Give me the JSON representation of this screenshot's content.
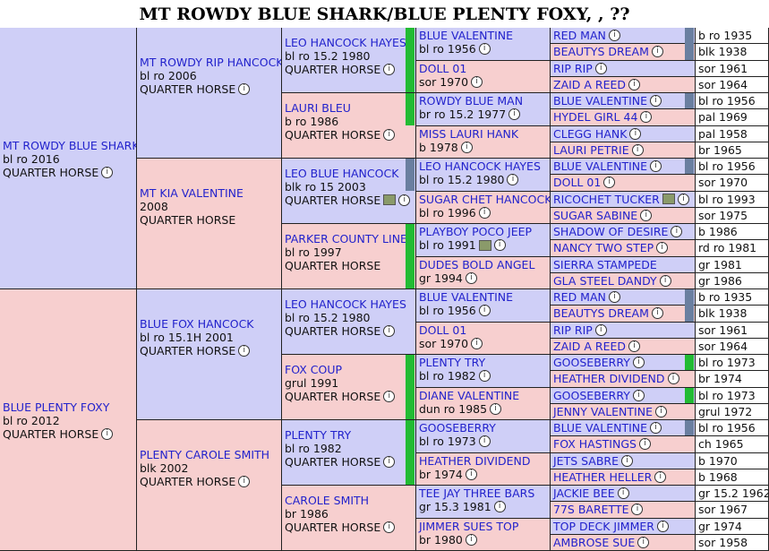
{
  "title": "MT ROWDY BLUE SHARK/BLUE PLENTY FOXY, , ??",
  "gen1": [
    {
      "name": "MT ROWDY BLUE SHARK",
      "line2": "bl ro 2016",
      "line3": "QUARTER HORSE"
    },
    {
      "name": "BLUE PLENTY FOXY",
      "line2": "bl ro 2012",
      "line3": "QUARTER HORSE"
    }
  ],
  "gen2": [
    {
      "name": "MT ROWDY RIP HANCOCK",
      "line2": "bl ro 2006",
      "line3": "QUARTER HORSE"
    },
    {
      "name": "MT KIA VALENTINE",
      "line2": "2008",
      "line3": "QUARTER HORSE"
    },
    {
      "name": "BLUE FOX HANCOCK",
      "line2": "bl ro 15.1H 2001",
      "line3": "QUARTER HORSE"
    },
    {
      "name": "PLENTY CAROLE SMITH",
      "line2": "blk 2002",
      "line3": "QUARTER HORSE"
    }
  ],
  "gen3": [
    {
      "name": "LEO HANCOCK HAYES",
      "line2": "bl ro 15.2 1980",
      "line3": "QUARTER HORSE"
    },
    {
      "name": "LAURI BLEU",
      "line2": "b ro 1986",
      "line3": "QUARTER HORSE"
    },
    {
      "name": "LEO BLUE HANCOCK",
      "line2": "blk ro 15 2003",
      "line3": "QUARTER HORSE"
    },
    {
      "name": "PARKER COUNTY LINE",
      "line2": "bl ro 1997",
      "line3": "QUARTER HORSE"
    },
    {
      "name": "LEO HANCOCK HAYES",
      "line2": "bl ro 15.2 1980",
      "line3": "QUARTER HORSE"
    },
    {
      "name": "FOX COUP",
      "line2": "grul 1991",
      "line3": "QUARTER HORSE"
    },
    {
      "name": "PLENTY TRY",
      "line2": "bl ro 1982",
      "line3": "QUARTER HORSE"
    },
    {
      "name": "CAROLE SMITH",
      "line2": "br 1986",
      "line3": "QUARTER HORSE"
    }
  ],
  "gen4": [
    {
      "name": "BLUE VALENTINE",
      "line2": "bl ro 1956"
    },
    {
      "name": "DOLL 01",
      "line2": "sor 1970"
    },
    {
      "name": "ROWDY BLUE MAN",
      "line2": "br ro 15.2 1977"
    },
    {
      "name": "MISS LAURI HANK",
      "line2": "b 1978"
    },
    {
      "name": "LEO HANCOCK HAYES",
      "line2": "bl ro 15.2 1980"
    },
    {
      "name": "SUGAR CHET HANCOCK",
      "line2": "bl ro 1996"
    },
    {
      "name": "PLAYBOY POCO JEEP",
      "line2": "bl ro 1991"
    },
    {
      "name": "DUDES BOLD ANGEL",
      "line2": "gr 1994"
    },
    {
      "name": "BLUE VALENTINE",
      "line2": "bl ro 1956"
    },
    {
      "name": "DOLL 01",
      "line2": "sor 1970"
    },
    {
      "name": "PLENTY TRY",
      "line2": "bl ro 1982"
    },
    {
      "name": "DIANE VALENTINE",
      "line2": "dun ro 1985"
    },
    {
      "name": "GOOSEBERRY",
      "line2": "bl ro 1973"
    },
    {
      "name": "HEATHER DIVIDEND",
      "line2": "br 1974"
    },
    {
      "name": "TEE JAY THREE BARS",
      "line2": "gr 15.3 1981"
    },
    {
      "name": "JIMMER SUES TOP",
      "line2": "br 1980"
    }
  ],
  "gen5": [
    {
      "name": "RED MAN",
      "info": "b ro 1935"
    },
    {
      "name": "BEAUTYS DREAM",
      "info": "blk 1938"
    },
    {
      "name": "RIP RIP",
      "info": "sor 1961"
    },
    {
      "name": "ZAID A REED",
      "info": "sor 1964"
    },
    {
      "name": "BLUE VALENTINE",
      "info": "bl ro 1956"
    },
    {
      "name": "HYDEL GIRL 44",
      "info": "pal 1969"
    },
    {
      "name": "CLEGG HANK",
      "info": "pal 1958"
    },
    {
      "name": "LAURI PETRIE",
      "info": "br 1965"
    },
    {
      "name": "BLUE VALENTINE",
      "info": "bl ro 1956"
    },
    {
      "name": "DOLL 01",
      "info": "sor 1970"
    },
    {
      "name": "RICOCHET TUCKER",
      "info": "bl ro 1993"
    },
    {
      "name": "SUGAR SABINE",
      "info": "sor 1975"
    },
    {
      "name": "SHADOW OF DESIRE",
      "info": "b 1986"
    },
    {
      "name": "NANCY TWO STEP",
      "info": "rd ro 1981"
    },
    {
      "name": "SIERRA STAMPEDE",
      "info": "gr 1981"
    },
    {
      "name": "GLA STEEL DANDY",
      "info": "gr 1986"
    },
    {
      "name": "RED MAN",
      "info": "b ro 1935"
    },
    {
      "name": "BEAUTYS DREAM",
      "info": "blk 1938"
    },
    {
      "name": "RIP RIP",
      "info": "sor 1961"
    },
    {
      "name": "ZAID A REED",
      "info": "sor 1964"
    },
    {
      "name": "GOOSEBERRY",
      "info": "bl ro 1973"
    },
    {
      "name": "HEATHER DIVIDEND",
      "info": "br 1974"
    },
    {
      "name": "GOOSEBERRY",
      "info": "bl ro 1973"
    },
    {
      "name": "JENNY VALENTINE",
      "info": "grul 1972"
    },
    {
      "name": "BLUE VALENTINE",
      "info": "bl ro 1956"
    },
    {
      "name": "FOX HASTINGS",
      "info": "ch 1965"
    },
    {
      "name": "JETS SABRE",
      "info": "b 1970"
    },
    {
      "name": "HEATHER HELLER",
      "info": "b 1968"
    },
    {
      "name": "JACKIE BEE",
      "info": "gr 15.2 1962"
    },
    {
      "name": "77S BARETTE",
      "info": "sor 1967"
    },
    {
      "name": "TOP DECK JIMMER",
      "info": "gr 1974"
    },
    {
      "name": "AMBROSE SUE",
      "info": "sor 1958"
    }
  ],
  "colors": {
    "male": "#cfcff7",
    "female": "#f7cfcf",
    "link": "#2222cc",
    "green": "#22bb33",
    "slate": "#6a7fa0"
  },
  "icons": {
    "info": "i",
    "photo": "photo-icon"
  }
}
